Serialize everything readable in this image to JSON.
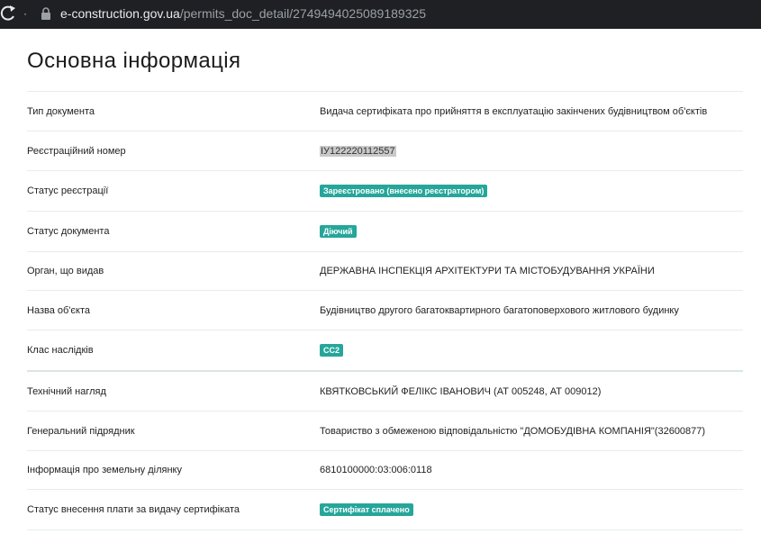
{
  "browser": {
    "url_host": "e-construction.gov.ua",
    "url_path": "/permits_doc_detail/2749494025089189325"
  },
  "page": {
    "title": "Основна інформація"
  },
  "rows": [
    {
      "label": "Тип документа",
      "value": "Видача сертифіката про прийняття в експлуатацію закінчених будівництвом об'єктів",
      "kind": "text"
    },
    {
      "label": "Реєстраційний номер",
      "value": "ІУ122220112557",
      "kind": "highlight"
    },
    {
      "label": "Статус реєстрації",
      "value": "Зареєстровано (внесено реєстратором)",
      "kind": "badge"
    },
    {
      "label": "Статус документа",
      "value": "Діючий",
      "kind": "badge"
    },
    {
      "label": "Орган, що видав",
      "value": "ДЕРЖАВНА ІНСПЕКЦІЯ АРХІТЕКТУРИ ТА МІСТОБУДУВАННЯ УКРАЇНИ",
      "kind": "text"
    },
    {
      "label": "Назва об'єкта",
      "value": "Будівництво другого багатоквартирного багатоповерхового житлового будинку",
      "kind": "text"
    },
    {
      "label": "Клас наслідків",
      "value": "СС2",
      "kind": "badge"
    },
    {
      "label": "Технічний нагляд",
      "value": "КВЯТКОВСЬКИЙ ФЕЛІКС ІВАНОВИЧ (АТ 005248, АТ 009012)",
      "kind": "text"
    },
    {
      "label": "Генеральний підрядник",
      "value": "Товариство з обмеженою відповідальністю \"ДОМОБУДІВНА КОМПАНІЯ\"(32600877)",
      "kind": "text"
    },
    {
      "label": "Інформація про земельну ділянку",
      "value": "6810100000:03:006:0118",
      "kind": "text"
    },
    {
      "label": "Статус внесення плати за видачу сертифіката",
      "value": "Сертифікат сплачено",
      "kind": "badge"
    }
  ],
  "colors": {
    "badge": "#26a69a",
    "browser_bar": "#1f2023",
    "divider": "#e7ecec"
  }
}
